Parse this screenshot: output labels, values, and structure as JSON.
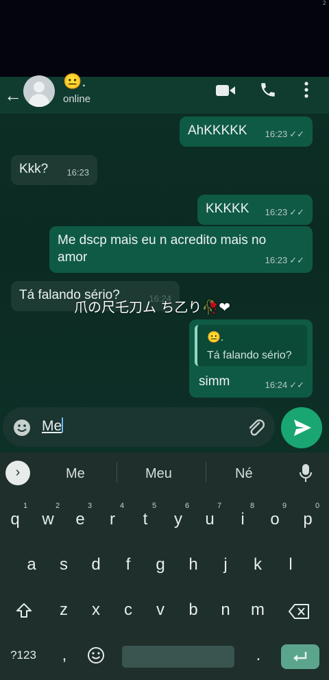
{
  "corner_tag": "2",
  "header": {
    "back_icon": "←",
    "contact_emoji": "😐.",
    "status": "online"
  },
  "messages": [
    {
      "dir": "out",
      "text": "AhKKKKK",
      "time": "16:23",
      "ticks": "✓✓"
    },
    {
      "dir": "in",
      "text": "Kkk?",
      "time": "16:23"
    },
    {
      "dir": "out",
      "text": "KKKKK",
      "time": "16:23",
      "ticks": "✓✓"
    },
    {
      "dir": "out",
      "text": "Me dscp mais eu n acredito mais no amor",
      "time": "16:23",
      "ticks": "✓✓"
    },
    {
      "dir": "in",
      "text": "Tá falando sério?",
      "time": "16:24"
    },
    {
      "dir": "out",
      "quote_emoji": "😐.",
      "quote_text": "Tá falando sério?",
      "text": "simm",
      "time": "16:24",
      "ticks": "✓✓"
    }
  ],
  "overlay_text": "爪の尺乇刀ム ち乙り🥀❤",
  "input": {
    "value": "Me"
  },
  "keyboard": {
    "suggestions": [
      "Me",
      "Meu",
      "Né"
    ],
    "row1": [
      "q",
      "w",
      "e",
      "r",
      "t",
      "y",
      "u",
      "i",
      "o",
      "p"
    ],
    "row1_hints": [
      "1",
      "2",
      "3",
      "4",
      "5",
      "6",
      "7",
      "8",
      "9",
      "0"
    ],
    "row2": [
      "a",
      "s",
      "d",
      "f",
      "g",
      "h",
      "j",
      "k",
      "l"
    ],
    "row3": [
      "z",
      "x",
      "c",
      "v",
      "b",
      "n",
      "m"
    ],
    "symbols_key": "?123",
    "comma_key": ",",
    "period_key": "."
  },
  "colors": {
    "outgoing": "#0f5a45",
    "incoming": "#1d3b33",
    "send": "#1aa672",
    "header": "#103c30"
  }
}
